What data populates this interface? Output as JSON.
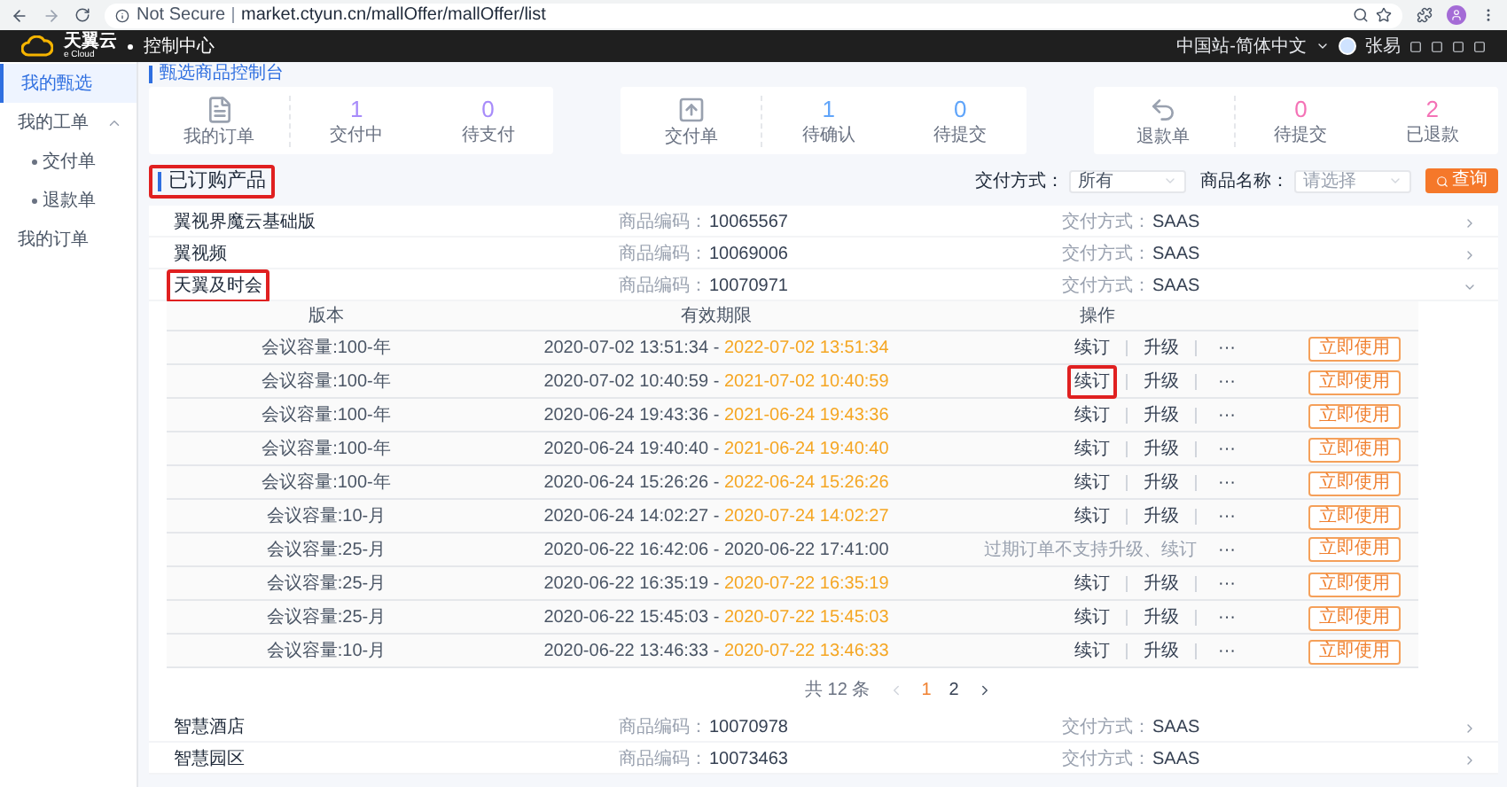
{
  "browser": {
    "security": "Not Secure",
    "url": "market.ctyun.cn/mallOffer/mallOffer/list"
  },
  "header": {
    "logo_text": "天翼云",
    "logo_subtext": "e Cloud",
    "title": "控制中心",
    "region": "中国站-简体中文",
    "user": "张易"
  },
  "sidebar": {
    "items": [
      {
        "label": "我的甄选",
        "selected": true
      },
      {
        "label": "我的工单",
        "selected": false,
        "expanded": true,
        "children": [
          {
            "label": "交付单",
            "selected": false
          },
          {
            "label": "退款单",
            "selected": false
          }
        ]
      },
      {
        "label": "我的订单",
        "selected": false
      }
    ]
  },
  "breadcrumb": "甄选商品控制台",
  "stat_cards": [
    {
      "label": "我的订单",
      "kind": "file",
      "color": "#a78bfa",
      "stats": [
        {
          "value": "1",
          "label": "交付中"
        },
        {
          "value": "0",
          "label": "待支付"
        }
      ]
    },
    {
      "label": "交付单",
      "kind": "upload",
      "color": "#60a5fa",
      "stats": [
        {
          "value": "1",
          "label": "待确认"
        },
        {
          "value": "0",
          "label": "待提交"
        }
      ]
    },
    {
      "label": "退款单",
      "kind": "undo",
      "color": "#f472b6",
      "stats": [
        {
          "value": "0",
          "label": "待提交"
        },
        {
          "value": "2",
          "label": "已退款"
        }
      ]
    }
  ],
  "section": {
    "title": "已订购产品",
    "highlighted": true
  },
  "filters": [
    {
      "label": "交付方式：",
      "value": "所有"
    },
    {
      "label": "商品名称：",
      "placeholder": "请选择"
    }
  ],
  "search_button": "查询",
  "products": [
    {
      "name": "翼视界魔云基础版",
      "code_label": "商品编码：",
      "code": "10065567",
      "delivery_label": "交付方式：",
      "delivery": "SAAS",
      "expanded": false,
      "highlighted": false
    },
    {
      "name": "翼视频",
      "code_label": "商品编码：",
      "code": "10069006",
      "delivery_label": "交付方式：",
      "delivery": "SAAS",
      "expanded": false,
      "highlighted": false
    },
    {
      "name": "天翼及时会",
      "code_label": "商品编码：",
      "code": "10070971",
      "delivery_label": "交付方式：",
      "delivery": "SAAS",
      "expanded": true,
      "highlighted": true,
      "table": {
        "columns": [
          "版本",
          "有效期限",
          "操作"
        ],
        "rows": [
          {
            "kind": "active",
            "version": "会议容量:100-年",
            "start": "2020-07-02 13:51:34",
            "dash": "-",
            "end": "2022-07-02 13:51:34",
            "actions": [
              {
                "label": "续订",
                "highlighted": false
              },
              {
                "label": "升级",
                "highlighted": false
              }
            ],
            "more": "···",
            "use_button": "立即使用"
          },
          {
            "kind": "active",
            "version": "会议容量:100-年",
            "start": "2020-07-02 10:40:59",
            "dash": "-",
            "end": "2021-07-02 10:40:59",
            "actions": [
              {
                "label": "续订",
                "highlighted": true
              },
              {
                "label": "升级",
                "highlighted": false
              }
            ],
            "more": "···",
            "use_button": "立即使用"
          },
          {
            "kind": "active",
            "version": "会议容量:100-年",
            "start": "2020-06-24 19:43:36",
            "dash": "-",
            "end": "2021-06-24 19:43:36",
            "actions": [
              {
                "label": "续订",
                "highlighted": false
              },
              {
                "label": "升级",
                "highlighted": false
              }
            ],
            "more": "···",
            "use_button": "立即使用"
          },
          {
            "kind": "active",
            "version": "会议容量:100-年",
            "start": "2020-06-24 19:40:40",
            "dash": "-",
            "end": "2021-06-24 19:40:40",
            "actions": [
              {
                "label": "续订",
                "highlighted": false
              },
              {
                "label": "升级",
                "highlighted": false
              }
            ],
            "more": "···",
            "use_button": "立即使用"
          },
          {
            "kind": "active",
            "version": "会议容量:100-年",
            "start": "2020-06-24 15:26:26",
            "dash": "-",
            "end": "2022-06-24 15:26:26",
            "actions": [
              {
                "label": "续订",
                "highlighted": false
              },
              {
                "label": "升级",
                "highlighted": false
              }
            ],
            "more": "···",
            "use_button": "立即使用"
          },
          {
            "kind": "active",
            "version": "会议容量:10-月",
            "start": "2020-06-24 14:02:27",
            "dash": "-",
            "end": "2020-07-24 14:02:27",
            "actions": [
              {
                "label": "续订",
                "highlighted": false
              },
              {
                "label": "升级",
                "highlighted": false
              }
            ],
            "more": "···",
            "use_button": "立即使用"
          },
          {
            "kind": "expired",
            "version": "会议容量:25-月",
            "start": "2020-06-22 16:42:06",
            "dash": "-",
            "end": "2020-06-22 17:41:00",
            "note": "过期订单不支持升级、续订",
            "more": "···",
            "use_button": "立即使用"
          },
          {
            "kind": "active",
            "version": "会议容量:25-月",
            "start": "2020-06-22 16:35:19",
            "dash": "-",
            "end": "2020-07-22 16:35:19",
            "actions": [
              {
                "label": "续订",
                "highlighted": false
              },
              {
                "label": "升级",
                "highlighted": false
              }
            ],
            "more": "···",
            "use_button": "立即使用"
          },
          {
            "kind": "active",
            "version": "会议容量:25-月",
            "start": "2020-06-22 15:45:03",
            "dash": "-",
            "end": "2020-07-22 15:45:03",
            "actions": [
              {
                "label": "续订",
                "highlighted": false
              },
              {
                "label": "升级",
                "highlighted": false
              }
            ],
            "more": "···",
            "use_button": "立即使用"
          },
          {
            "kind": "active",
            "version": "会议容量:10-月",
            "start": "2020-06-22 13:46:33",
            "dash": "-",
            "end": "2020-07-22 13:46:33",
            "actions": [
              {
                "label": "续订",
                "highlighted": false
              },
              {
                "label": "升级",
                "highlighted": false
              }
            ],
            "more": "···",
            "use_button": "立即使用"
          }
        ]
      },
      "pagination": {
        "total": "共 12 条",
        "pages": [
          {
            "label": "1",
            "selected": true
          },
          {
            "label": "2",
            "selected": false
          }
        ]
      }
    },
    {
      "name": "智慧酒店",
      "code_label": "商品编码：",
      "code": "10070978",
      "delivery_label": "交付方式：",
      "delivery": "SAAS",
      "expanded": false,
      "highlighted": false
    },
    {
      "name": "智慧园区",
      "code_label": "商品编码：",
      "code": "10073463",
      "delivery_label": "交付方式：",
      "delivery": "SAAS",
      "expanded": false,
      "highlighted": false
    }
  ]
}
